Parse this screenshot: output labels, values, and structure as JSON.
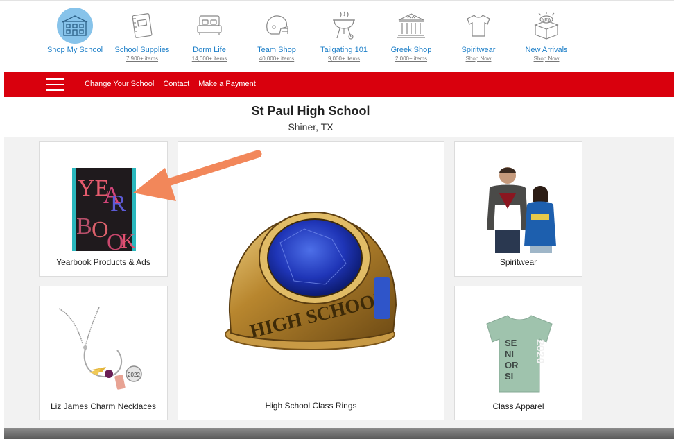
{
  "categories": [
    {
      "label": "Shop My School",
      "sub": "",
      "icon": "school-building-icon",
      "active": true
    },
    {
      "label": "School Supplies",
      "sub": "7,900+ items",
      "icon": "notebook-icon"
    },
    {
      "label": "Dorm Life",
      "sub": "14,000+ items",
      "icon": "bed-icon"
    },
    {
      "label": "Team Shop",
      "sub": "40,000+ items",
      "icon": "football-helmet-icon"
    },
    {
      "label": "Tailgating 101",
      "sub": "9,000+ items",
      "icon": "grill-icon"
    },
    {
      "label": "Greek Shop",
      "sub": "2,000+ items",
      "icon": "greek-building-icon"
    },
    {
      "label": "Spiritwear",
      "sub": "Shop Now",
      "icon": "tshirt-icon"
    },
    {
      "label": "New Arrivals",
      "sub": "Shop Now",
      "icon": "new-box-icon"
    }
  ],
  "nav": {
    "change_school": "Change Your School",
    "contact": "Contact",
    "payment": "Make a Payment"
  },
  "school": {
    "name": "St Paul High School",
    "location": "Shiner, TX"
  },
  "products": {
    "yearbook": {
      "caption": "Yearbook Products & Ads",
      "cover_text": "YEARBOOK"
    },
    "rings": {
      "caption": "High School Class Rings",
      "ring_text": "HIGH SCHOOL"
    },
    "spiritwear": {
      "caption": "Spiritwear"
    },
    "necklaces": {
      "caption": "Liz James Charm Necklaces",
      "charm_text": "2022"
    },
    "apparel": {
      "caption": "Class Apparel",
      "shirt_text": "SENIORS 2020"
    }
  },
  "colors": {
    "brand_red": "#d9000d",
    "link_blue": "#1d7fc8",
    "active_icon_bg": "#87c3ea",
    "arrow": "#f2875a"
  }
}
